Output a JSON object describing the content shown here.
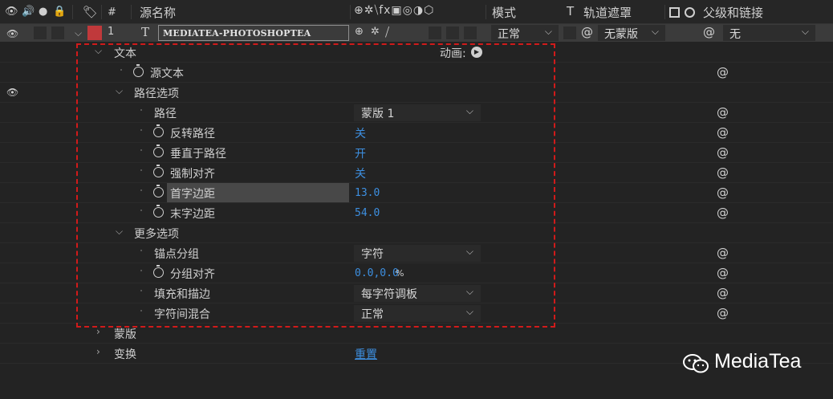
{
  "header": {
    "col_hash": "#",
    "col_source_name": "源名称",
    "col_mode": "模式",
    "col_t": "T",
    "col_track_matte": "轨道遮罩",
    "col_parent": "父级和链接",
    "switch_icons": "⊕✲⧹fx▣◎◑⬡"
  },
  "layer": {
    "number": "1",
    "type_glyph": "T",
    "name": "MEDIATEA-PHOTOSHOPTEA",
    "label_color": "#c0393b",
    "mode": "正常",
    "matte": "无蒙版",
    "parent": "无"
  },
  "props": {
    "text_group": "文本",
    "animate_label": "动画:",
    "source_text": "源文本",
    "path_options": "路径选项",
    "path_label": "路径",
    "path_value": "蒙版 1",
    "reverse_path": "反转路径",
    "reverse_path_value": "关",
    "perpendicular": "垂直于路径",
    "perpendicular_value": "开",
    "force_align": "强制对齐",
    "force_align_value": "关",
    "first_margin": "首字边距",
    "first_margin_value": "13.0",
    "last_margin": "末字边距",
    "last_margin_value": "54.0",
    "more_options": "更多选项",
    "anchor_grouping": "锚点分组",
    "anchor_grouping_value": "字符",
    "grouping_alignment": "分组对齐",
    "grouping_alignment_value": "0.0,0.0",
    "grouping_alignment_unit": "%",
    "fill_stroke": "填充和描边",
    "fill_stroke_value": "每字符调板",
    "inter_char_blend": "字符间混合",
    "inter_char_blend_value": "正常",
    "masks": "蒙版",
    "transform": "变换",
    "transform_reset": "重置"
  },
  "watermark": "MediaTea",
  "colors": {
    "accent_blue": "#3d8fe0",
    "highlight_box": "#d11a1a"
  }
}
